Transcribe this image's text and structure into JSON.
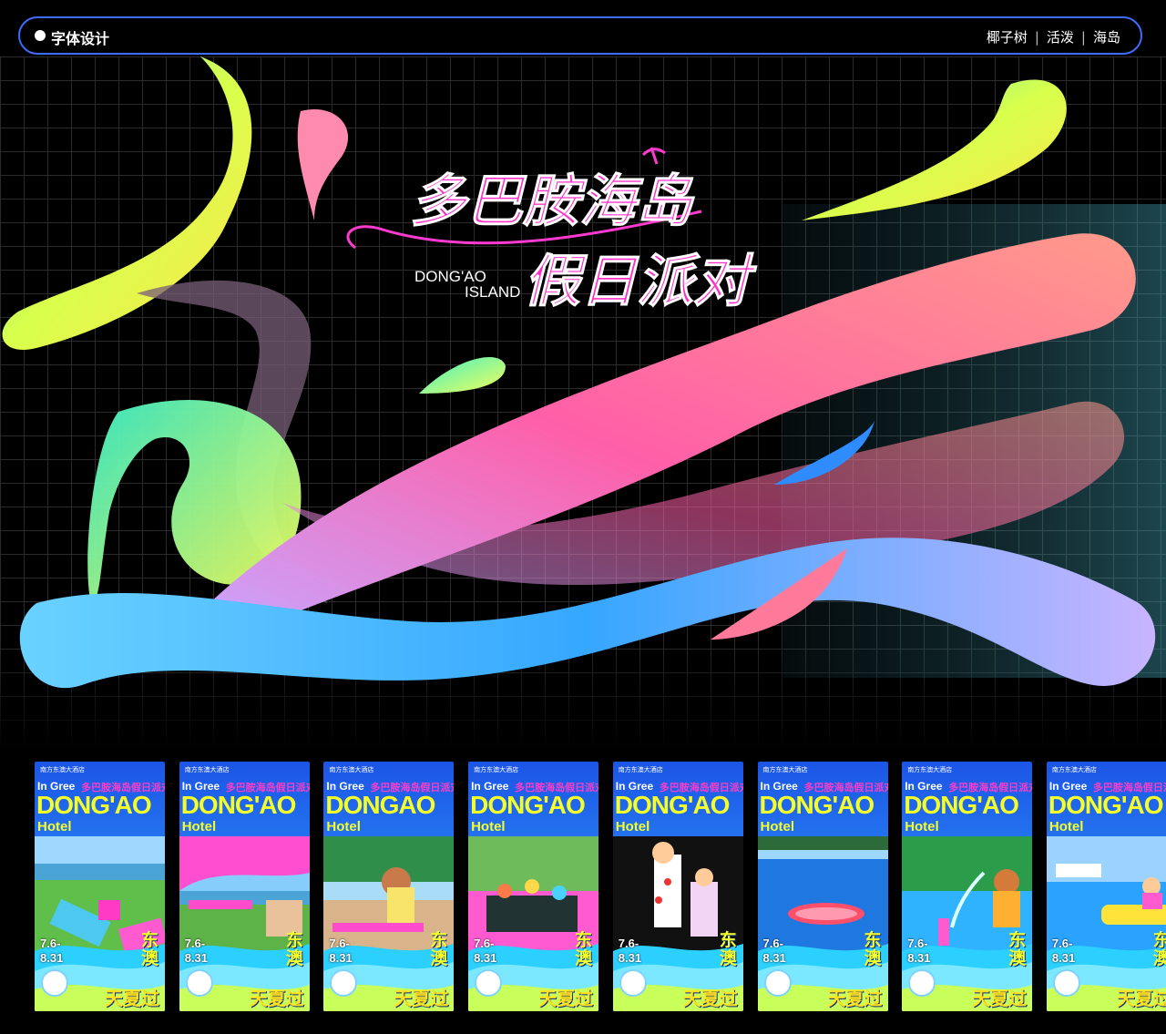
{
  "header": {
    "left_label": "字体设计",
    "right_tags": [
      "椰子树",
      "活泼",
      "海岛"
    ],
    "separator": "|"
  },
  "hero": {
    "title_line1": "多巴胺海岛",
    "title_line2": "假日派对",
    "en_line1": "DONG'AO",
    "en_line2": "ISLAND"
  },
  "posters": [
    {
      "head": "南方东澳大酒店",
      "in": "In Gree",
      "sub": "多巴胺海岛假日派对",
      "big": "DONG'AO",
      "hotel": "Hotel",
      "d1": "7.6-",
      "d2": "8.31",
      "dongao": "东澳",
      "slogan": "天夏过",
      "theme": "lawn"
    },
    {
      "head": "南方东澳大酒店",
      "in": "In Gree",
      "sub": "多巴胺海岛假日派对",
      "big": "DONG'AO",
      "hotel": "Hotel",
      "d1": "7.6-",
      "d2": "8.31",
      "dongao": "东澳",
      "slogan": "天夏过",
      "theme": "tent"
    },
    {
      "head": "南方东澳大酒店",
      "in": "In Gree",
      "sub": "多巴胺海岛假日派对",
      "big": "DONGAO",
      "hotel": "Hotel",
      "d1": "7.6-",
      "d2": "8.31",
      "dongao": "东澳",
      "slogan": "天夏过",
      "theme": "lady"
    },
    {
      "head": "南方东澳大酒店",
      "in": "In Gree",
      "sub": "多巴胺海岛假日派对",
      "big": "DONG'AO",
      "hotel": "Hotel",
      "d1": "7.6-",
      "d2": "8.31",
      "dongao": "东澳",
      "slogan": "天夏过",
      "theme": "food"
    },
    {
      "head": "南方东澳大酒店",
      "in": "In Gree",
      "sub": "多巴胺海岛假日派对",
      "big": "DONG'AO",
      "hotel": "Hotel",
      "d1": "7.6-",
      "d2": "8.31",
      "dongao": "东澳",
      "slogan": "天夏过",
      "theme": "clown"
    },
    {
      "head": "南方东澳大酒店",
      "in": "In Gree",
      "sub": "多巴胺海岛假日派对",
      "big": "DONG'AO",
      "hotel": "Hotel",
      "d1": "7.6-",
      "d2": "8.31",
      "dongao": "东澳",
      "slogan": "天夏过",
      "theme": "pool"
    },
    {
      "head": "南方东澳大酒店",
      "in": "In Gree",
      "sub": "多巴胺海岛假日派对",
      "big": "DONG'AO",
      "hotel": "Hotel",
      "d1": "7.6-",
      "d2": "8.31",
      "dongao": "东澳",
      "slogan": "天夏过",
      "theme": "splash"
    },
    {
      "head": "南方东澳大酒店",
      "in": "In Gree",
      "sub": "多巴胺海岛假日派对",
      "big": "DONG'AO",
      "hotel": "Hotel",
      "d1": "7.6-",
      "d2": "8.31",
      "dongao": "东澳",
      "slogan": "天夏过",
      "theme": "float"
    }
  ]
}
